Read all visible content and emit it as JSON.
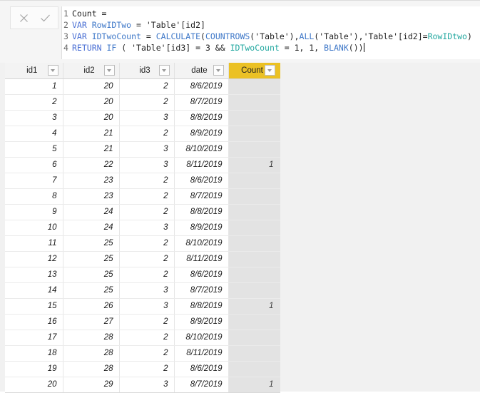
{
  "formula_bar": {
    "cancel_icon": "close-x-icon",
    "commit_icon": "checkmark-icon",
    "lines": [
      {
        "num": "1",
        "tokens": [
          {
            "t": "Count =",
            "c": "plain"
          }
        ]
      },
      {
        "num": "2",
        "tokens": [
          {
            "t": "VAR ",
            "c": "kw"
          },
          {
            "t": "RowIDTwo",
            "c": "var"
          },
          {
            "t": " = 'Table'[id2]",
            "c": "plain"
          }
        ]
      },
      {
        "num": "3",
        "tokens": [
          {
            "t": "VAR ",
            "c": "kw"
          },
          {
            "t": "IDTwoCount",
            "c": "var"
          },
          {
            "t": " = ",
            "c": "plain"
          },
          {
            "t": "CALCULATE",
            "c": "fn"
          },
          {
            "t": "(",
            "c": "plain"
          },
          {
            "t": "COUNTROWS",
            "c": "fn"
          },
          {
            "t": "('Table'),",
            "c": "plain"
          },
          {
            "t": "ALL",
            "c": "fn"
          },
          {
            "t": "('Table'),'Table'[id2]=",
            "c": "plain"
          },
          {
            "t": "RowIDtwo",
            "c": "ref"
          },
          {
            "t": ")",
            "c": "plain"
          }
        ]
      },
      {
        "num": "4",
        "tokens": [
          {
            "t": "RETURN ",
            "c": "kw"
          },
          {
            "t": "IF",
            "c": "fn"
          },
          {
            "t": " ( 'Table'[id3] = 3 && ",
            "c": "plain"
          },
          {
            "t": "IDTwoCount",
            "c": "ref"
          },
          {
            "t": " = 1, 1, ",
            "c": "plain"
          },
          {
            "t": "BLANK",
            "c": "fn"
          },
          {
            "t": "())",
            "c": "plain"
          }
        ]
      }
    ],
    "caret_after_line": 4
  },
  "grid": {
    "columns": [
      {
        "key": "id1",
        "label": "id1",
        "filter_icon": "chevron-down-icon",
        "highlighted": false
      },
      {
        "key": "id2",
        "label": "id2",
        "filter_icon": "chevron-down-icon",
        "highlighted": false
      },
      {
        "key": "id3",
        "label": "id3",
        "filter_icon": "chevron-down-icon",
        "highlighted": false
      },
      {
        "key": "date",
        "label": "date",
        "filter_icon": "chevron-down-icon",
        "highlighted": false
      },
      {
        "key": "Count",
        "label": "Count",
        "filter_icon": "chevron-down-icon",
        "highlighted": true
      }
    ],
    "rows": [
      {
        "id1": "1",
        "id2": "20",
        "id3": "2",
        "date": "8/6/2019",
        "Count": ""
      },
      {
        "id1": "2",
        "id2": "20",
        "id3": "2",
        "date": "8/7/2019",
        "Count": ""
      },
      {
        "id1": "3",
        "id2": "20",
        "id3": "3",
        "date": "8/8/2019",
        "Count": ""
      },
      {
        "id1": "4",
        "id2": "21",
        "id3": "2",
        "date": "8/9/2019",
        "Count": ""
      },
      {
        "id1": "5",
        "id2": "21",
        "id3": "3",
        "date": "8/10/2019",
        "Count": ""
      },
      {
        "id1": "6",
        "id2": "22",
        "id3": "3",
        "date": "8/11/2019",
        "Count": "1"
      },
      {
        "id1": "7",
        "id2": "23",
        "id3": "2",
        "date": "8/6/2019",
        "Count": ""
      },
      {
        "id1": "8",
        "id2": "23",
        "id3": "2",
        "date": "8/7/2019",
        "Count": ""
      },
      {
        "id1": "9",
        "id2": "24",
        "id3": "2",
        "date": "8/8/2019",
        "Count": ""
      },
      {
        "id1": "10",
        "id2": "24",
        "id3": "3",
        "date": "8/9/2019",
        "Count": ""
      },
      {
        "id1": "11",
        "id2": "25",
        "id3": "2",
        "date": "8/10/2019",
        "Count": ""
      },
      {
        "id1": "12",
        "id2": "25",
        "id3": "2",
        "date": "8/11/2019",
        "Count": ""
      },
      {
        "id1": "13",
        "id2": "25",
        "id3": "2",
        "date": "8/6/2019",
        "Count": ""
      },
      {
        "id1": "14",
        "id2": "25",
        "id3": "3",
        "date": "8/7/2019",
        "Count": ""
      },
      {
        "id1": "15",
        "id2": "26",
        "id3": "3",
        "date": "8/8/2019",
        "Count": "1"
      },
      {
        "id1": "16",
        "id2": "27",
        "id3": "2",
        "date": "8/9/2019",
        "Count": ""
      },
      {
        "id1": "17",
        "id2": "28",
        "id3": "2",
        "date": "8/10/2019",
        "Count": ""
      },
      {
        "id1": "18",
        "id2": "28",
        "id3": "2",
        "date": "8/11/2019",
        "Count": ""
      },
      {
        "id1": "19",
        "id2": "28",
        "id3": "2",
        "date": "8/6/2019",
        "Count": ""
      },
      {
        "id1": "20",
        "id2": "29",
        "id3": "3",
        "date": "8/7/2019",
        "Count": "1"
      }
    ]
  },
  "colors": {
    "highlight_header": "#ebc124",
    "measure_column_bg": "#e3e3e3",
    "keyword": "#4a6fd4",
    "variable_ref": "#23a8a0",
    "function": "#3f78c8",
    "canvas_bg": "#f1f1f1"
  }
}
